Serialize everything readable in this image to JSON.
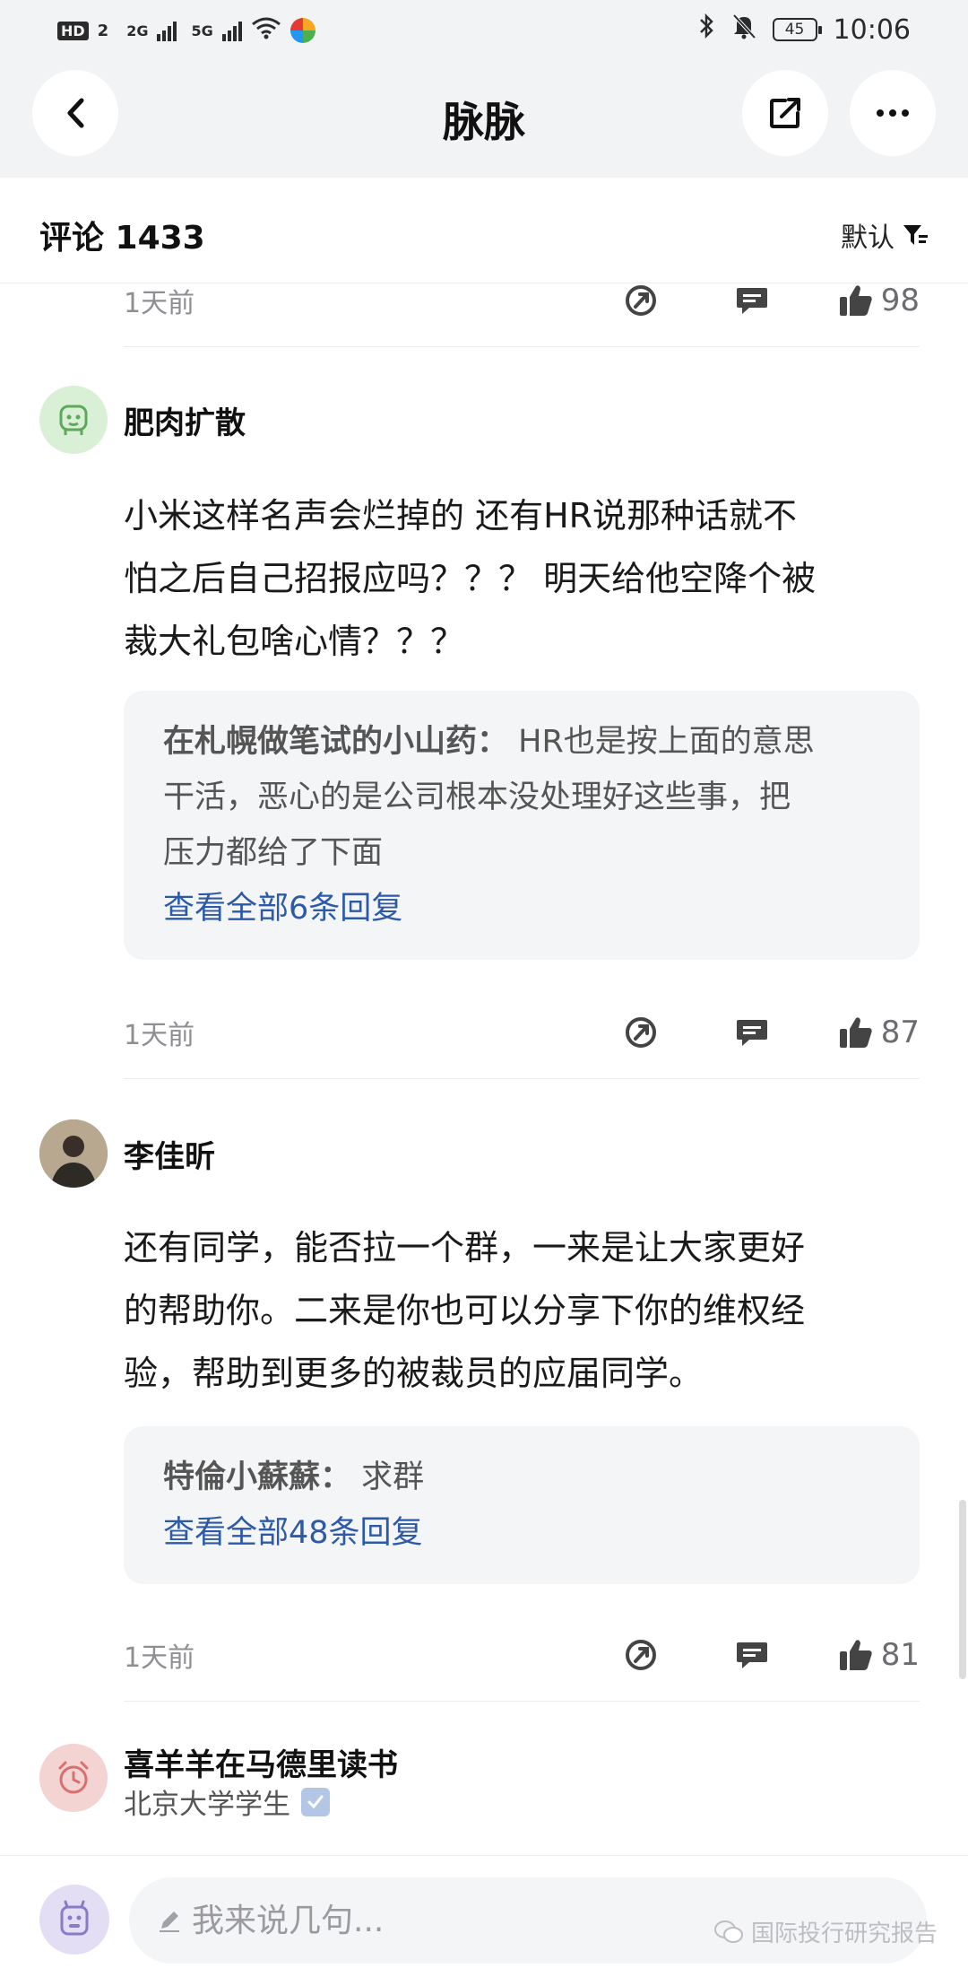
{
  "status_bar": {
    "hd": "HD",
    "sim_badge": "2",
    "net1": "2G",
    "net2": "5G",
    "battery": "45",
    "time": "10:06"
  },
  "header": {
    "title": "脉脉"
  },
  "comments_header": {
    "title": "评论 1433",
    "sort_label": "默认"
  },
  "top_meta": {
    "time": "1天前",
    "likes": "98"
  },
  "comments": [
    {
      "username": "肥肉扩散",
      "lines": [
        "小米这样名声会烂掉的 还有HR说那种话就不",
        "怕之后自己招报应吗？？？ 明天给他空降个被",
        "裁大礼包啥心情？？？"
      ],
      "reply": {
        "author": "在札幌做笔试的小山药：",
        "lines": [
          "HR也是按上面的意思",
          "干活，恶心的是公司根本没处理好这些事，把",
          "压力都给了下面"
        ],
        "more": "查看全部6条回复"
      },
      "time": "1天前",
      "likes": "87"
    },
    {
      "username": "李佳昕",
      "lines": [
        "还有同学，能否拉一个群，一来是让大家更好",
        "的帮助你。二来是你也可以分享下你的维权经",
        "验，帮助到更多的被裁员的应届同学。"
      ],
      "reply": {
        "author": "特倫小蘇蘇：",
        "lines": [
          "求群"
        ],
        "more": "查看全部48条回复"
      },
      "time": "1天前",
      "likes": "81"
    },
    {
      "username": "喜羊羊在马德里读书",
      "subtitle": "北京大学学生"
    }
  ],
  "input": {
    "placeholder": "我来说几句..."
  },
  "watermark": "国际投行研究报告",
  "colors": {
    "link": "#2d5aa8",
    "reply_bg": "#f4f5f7",
    "header_bg": "#f2f3f5"
  }
}
